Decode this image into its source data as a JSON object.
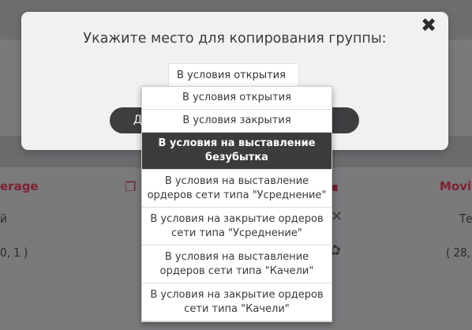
{
  "modal": {
    "title": "Укажите место для копирования группы:",
    "close_glyph": "✖",
    "select_value": "В условия открытия",
    "button_label": "Д"
  },
  "dropdown": {
    "options": [
      "В условия открытия",
      "В условия закрытия",
      "В условия на выставление безубытка",
      "В условия на выставление ордеров сети типа \"Усреднение\"",
      "В условия на закрытие ордеров сети типа \"Усреднение\"",
      "В условия на выставление ордеров сети типа \"Качели\"",
      "В условия на закрытие ордеров сети типа \"Качели\""
    ],
    "selected_index": 2
  },
  "background": {
    "left_heading": "erage",
    "right_heading": "Movin",
    "left_row1": "й",
    "left_row2": "0, 1 )",
    "right_row1": "Те",
    "right_row2": "( 28,"
  }
}
